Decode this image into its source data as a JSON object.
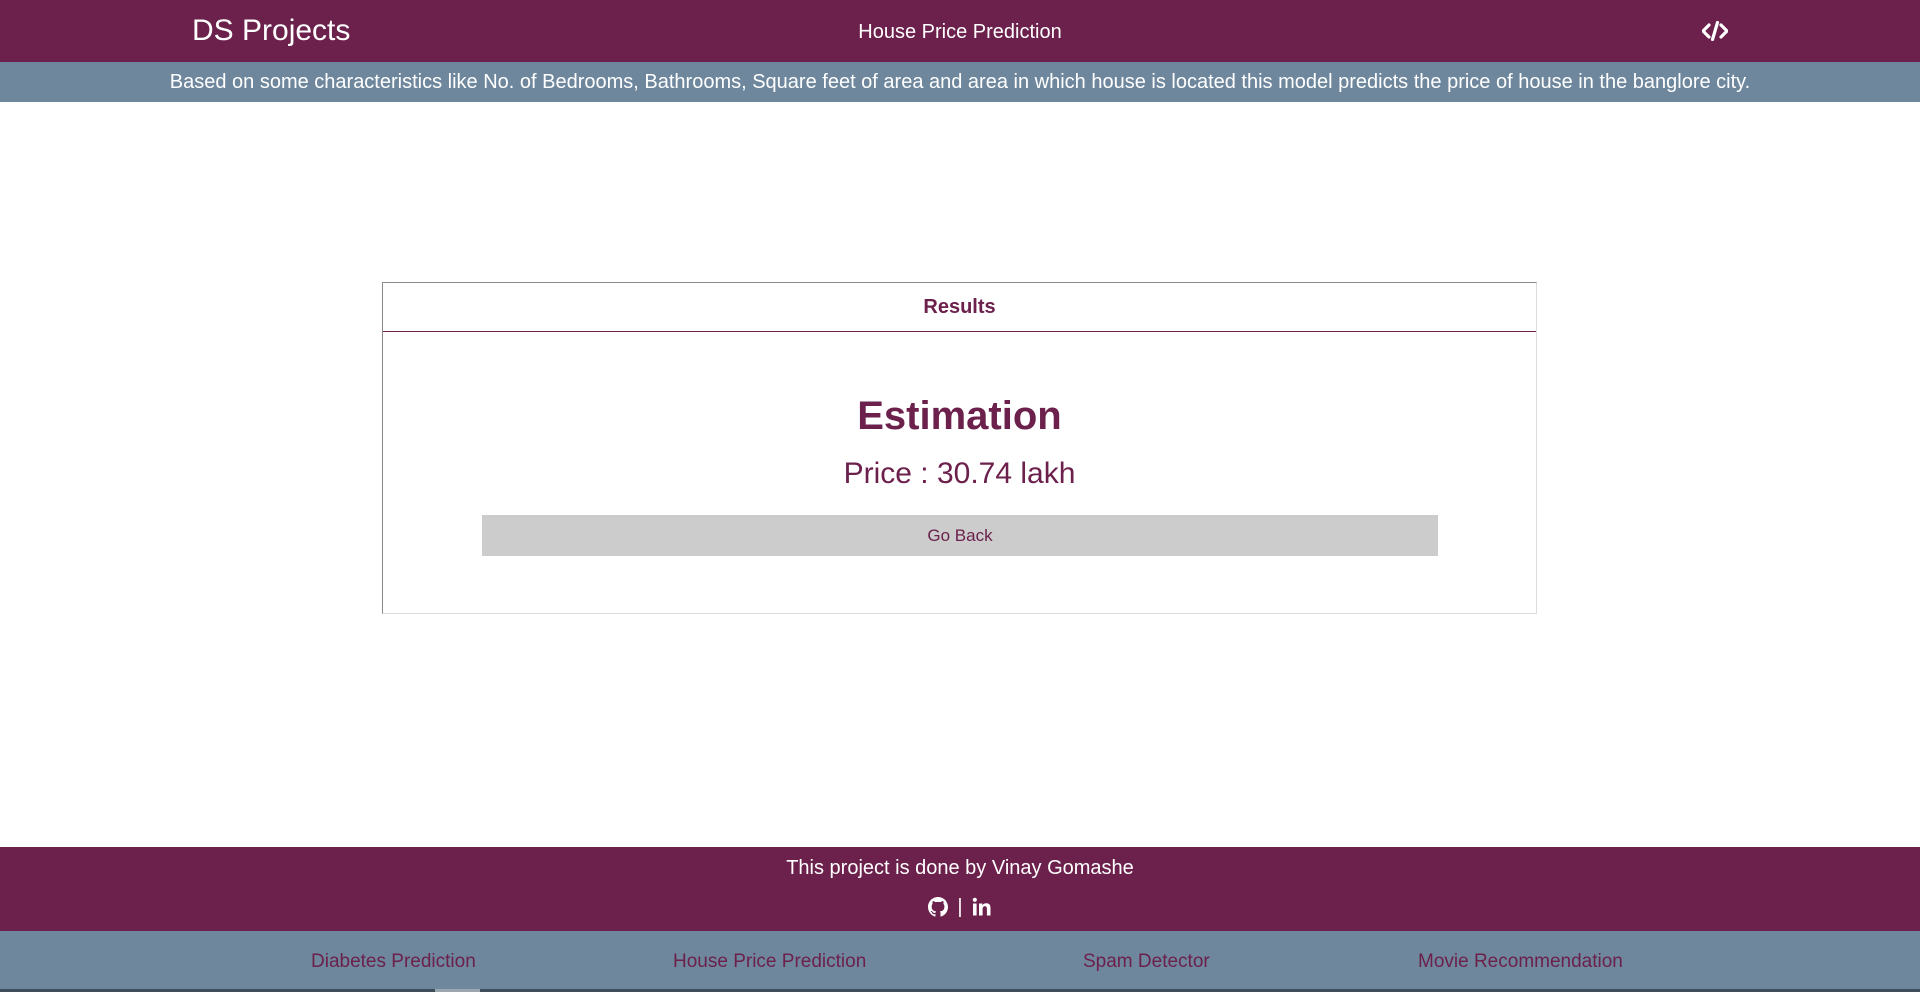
{
  "header": {
    "brand": "DS Projects",
    "title": "House Price Prediction",
    "code_icon": "code-icon"
  },
  "info_bar": {
    "text": "Based on some characteristics like No. of Bedrooms, Bathrooms, Square feet of area and area in which house is located this model predicts the price of house in the banglore city."
  },
  "results": {
    "header": "Results",
    "title": "Estimation",
    "price": "Price : 30.74 lakh",
    "go_back_label": "Go Back"
  },
  "footer": {
    "credit": "This project is done by Vinay Gomashe",
    "separator": "|",
    "icons": [
      "github-icon",
      "linkedin-icon"
    ]
  },
  "bottom_nav": {
    "items": [
      {
        "label": "Diabetes Prediction"
      },
      {
        "label": "House Price Prediction"
      },
      {
        "label": "Spam Detector"
      },
      {
        "label": "Movie Recommendation"
      }
    ]
  },
  "colors": {
    "primary": "#6c204c",
    "secondary": "#6e879d",
    "button_bg": "#cccccc"
  }
}
